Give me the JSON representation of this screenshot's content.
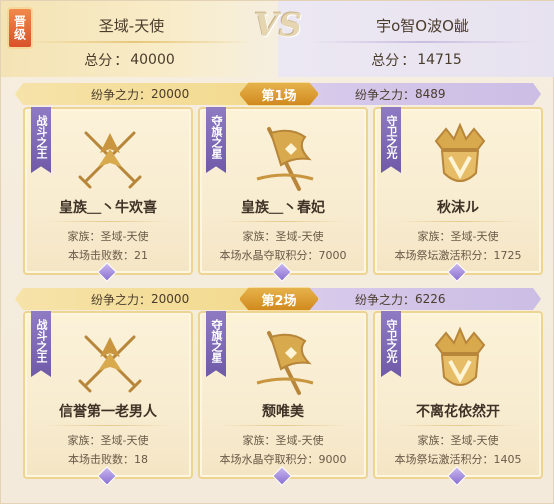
{
  "header": {
    "promo_badge": "晋级",
    "vs_label": "VS",
    "left_team": {
      "name": "圣域-天使",
      "score_label": "总分",
      "score_value": "40000"
    },
    "right_team": {
      "name": "宇o智O波O龇",
      "score_label": "总分",
      "score_value": "14715"
    }
  },
  "rounds": [
    {
      "label": "第1场",
      "left_power_label": "纷争之力",
      "left_power_value": "20000",
      "right_power_label": "纷争之力",
      "right_power_value": "8489",
      "cards": [
        {
          "tag": "战斗之王",
          "emblem": "crossed-swords-icon",
          "name": "皇族＿丶牛欢喜",
          "line1": "家族：圣域-天使",
          "line2": "本场击败数：21"
        },
        {
          "tag": "夺旗之星",
          "emblem": "flag-icon",
          "name": "皇族＿丶春妃",
          "line1": "家族：圣域-天使",
          "line2": "本场水晶夺取积分：7000"
        },
        {
          "tag": "守卫之光",
          "emblem": "crown-shield-icon",
          "name": "秋沫ル",
          "line1": "家族：圣域-天使",
          "line2": "本场祭坛激活积分：1725"
        }
      ]
    },
    {
      "label": "第2场",
      "left_power_label": "纷争之力",
      "left_power_value": "20000",
      "right_power_label": "纷争之力",
      "right_power_value": "6226",
      "cards": [
        {
          "tag": "战斗之王",
          "emblem": "crossed-swords-icon",
          "name": "信誉第一老男人",
          "line1": "家族：圣域-天使",
          "line2": "本场击败数：18"
        },
        {
          "tag": "夺旗之星",
          "emblem": "flag-icon",
          "name": "颓唯美",
          "line1": "家族：圣域-天使",
          "line2": "本场水晶夺取积分：9000"
        },
        {
          "tag": "守卫之光",
          "emblem": "crown-shield-icon",
          "name": "不离花依然开",
          "line1": "家族：圣域-天使",
          "line2": "本场祭坛激活积分：1405"
        }
      ]
    }
  ],
  "colors": {
    "gold_accent": "#d9a441",
    "purple_accent": "#7a64b4",
    "card_bg": "#fbf2d9"
  }
}
